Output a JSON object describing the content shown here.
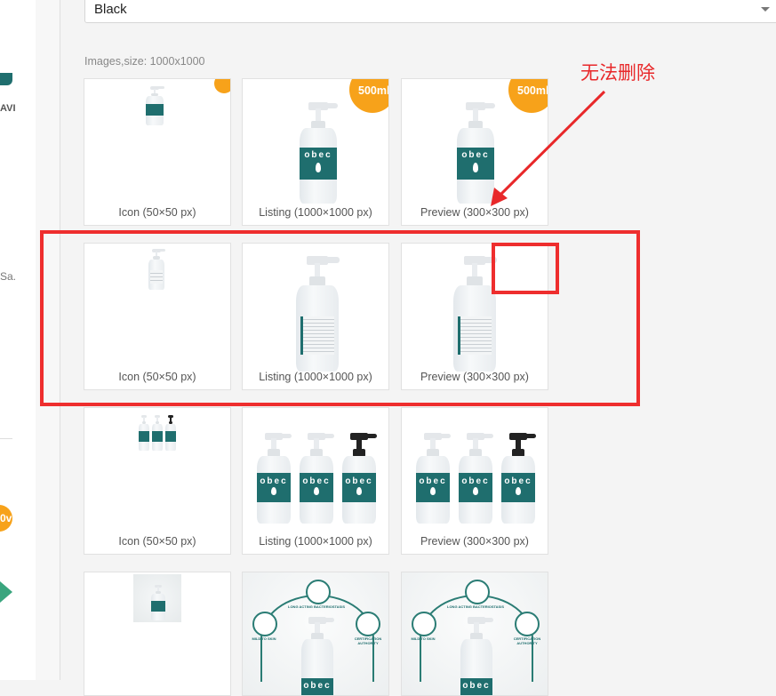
{
  "dropdown": {
    "selected": "Black"
  },
  "images_section": {
    "label": "Images,size: 1000x1000"
  },
  "image_rows": [
    {
      "badge": "500ml",
      "tiles": [
        {
          "caption": "Icon (50×50 px)"
        },
        {
          "caption": "Listing (1000×1000 px)"
        },
        {
          "caption": "Preview (300×300 px)"
        }
      ]
    },
    {
      "tiles": [
        {
          "caption": "Icon (50×50 px)"
        },
        {
          "caption": "Listing (1000×1000 px)"
        },
        {
          "caption": "Preview (300×300 px)"
        }
      ]
    },
    {
      "tiles": [
        {
          "caption": "Icon (50×50 px)"
        },
        {
          "caption": "Listing (1000×1000 px)"
        },
        {
          "caption": "Preview (300×300 px)"
        }
      ]
    },
    {
      "tiles": [
        {
          "caption": ""
        },
        {
          "caption": ""
        },
        {
          "caption": ""
        }
      ]
    }
  ],
  "product_brand": "obec",
  "infographic": {
    "left_text": "MILD TO SKIN",
    "center_text": "LONG ACTING BACTERIOSTASIS",
    "right_text": "CERTIFICATION AUTHORITY"
  },
  "annotation": {
    "text": "无法删除",
    "color": "#e8282a"
  },
  "left_panel": {
    "text_fragment": "AVI",
    "sa_fragment": "Sa.",
    "badge_fragment": "0v"
  },
  "colors": {
    "accent": "#f7a21a",
    "label": "#1f6e6e",
    "annotation": "#ee2e2e"
  }
}
